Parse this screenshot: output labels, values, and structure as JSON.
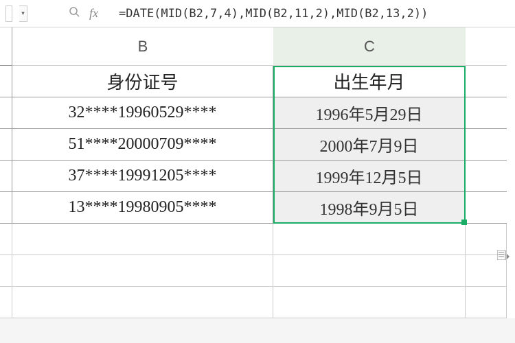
{
  "formula_bar": {
    "fx_label": "fx",
    "formula": "=DATE(MID(B2,7,4),MID(B2,11,2),MID(B2,13,2))"
  },
  "columns": {
    "b": "B",
    "c": "C"
  },
  "headers": {
    "id": "身份证号",
    "dob": "出生年月"
  },
  "rows": [
    {
      "id": "32****19960529****",
      "dob": "1996年5月29日"
    },
    {
      "id": "51****20000709****",
      "dob": "2000年7月9日"
    },
    {
      "id": "37****19991205****",
      "dob": "1999年12月5日"
    },
    {
      "id": "13****19980905****",
      "dob": "1998年9月5日"
    }
  ],
  "icons": {
    "search": "�search",
    "options": "畏"
  }
}
